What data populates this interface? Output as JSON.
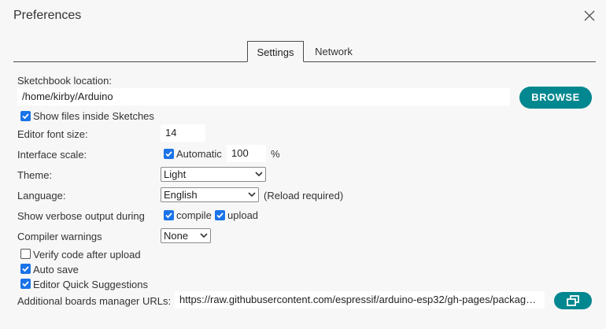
{
  "window": {
    "title": "Preferences"
  },
  "tabs": [
    {
      "label": "Settings"
    },
    {
      "label": "Network"
    }
  ],
  "sketchbook": {
    "label": "Sketchbook location:",
    "value": "/home/kirby/Arduino",
    "browse_label": "BROWSE"
  },
  "show_files": {
    "label": "Show files inside Sketches",
    "checked": true
  },
  "font_size": {
    "label": "Editor font size:",
    "value": "14"
  },
  "interface_scale": {
    "label": "Interface scale:",
    "automatic_label": "Automatic",
    "automatic_checked": true,
    "value": "100",
    "unit": "%"
  },
  "theme": {
    "label": "Theme:",
    "selected": "Light"
  },
  "language": {
    "label": "Language:",
    "selected": "English",
    "note": "(Reload required)"
  },
  "verbose": {
    "label": "Show verbose output during",
    "compile_label": "compile",
    "compile_checked": true,
    "upload_label": "upload",
    "upload_checked": true
  },
  "compiler_warnings": {
    "label": "Compiler warnings",
    "selected": "None"
  },
  "verify_after_upload": {
    "label": "Verify code after upload",
    "checked": false
  },
  "auto_save": {
    "label": "Auto save",
    "checked": true
  },
  "quick_suggestions": {
    "label": "Editor Quick Suggestions",
    "checked": true
  },
  "boards_urls": {
    "label": "Additional boards manager URLs:",
    "value": "https://raw.githubusercontent.com/espressif/arduino-esp32/gh-pages/package…"
  },
  "colors": {
    "accent": "#00878f",
    "checkbox": "#1a73e8",
    "background": "#f7f7f7"
  },
  "icons": {
    "close": "close-icon",
    "checkmark": "checkmark-icon",
    "chevron": "chevron-down-icon",
    "open_window": "open-window-icon"
  }
}
